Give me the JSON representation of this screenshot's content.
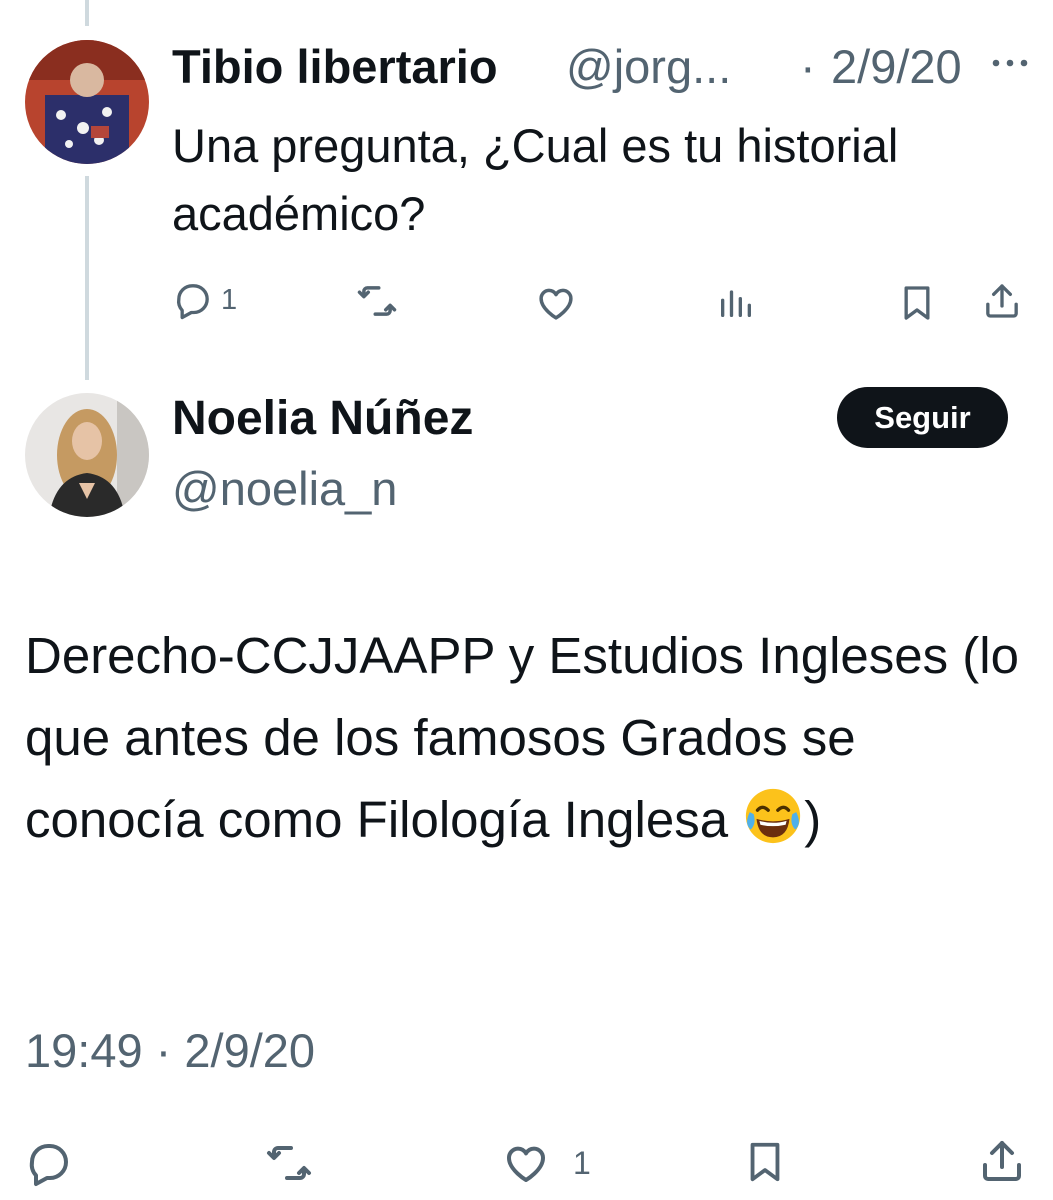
{
  "reply": {
    "name": "Tibio libertario",
    "handle": "@jorg...",
    "separator": "·",
    "date": "2/9/20",
    "text": "Una pregunta, ¿Cual es tu historial académico?",
    "actions": {
      "reply_count": "1"
    }
  },
  "main": {
    "name": "Noelia Núñez",
    "handle": "@noelia_n",
    "follow_label": "Seguir",
    "text": "Derecho-CCJJAAPP y Estudios Ingleses (lo que antes de los famosos Grados se conocía como Filología Inglesa",
    "text_end": ")",
    "emoji": "face-with-tears-of-joy",
    "timestamp": "19:49 · 2/9/20",
    "actions": {
      "like_count": "1"
    }
  },
  "colors": {
    "text": "#0f1419",
    "secondary": "#536471",
    "thread_line": "#cfd9de",
    "button_bg": "#0f1419",
    "button_text": "#ffffff"
  }
}
